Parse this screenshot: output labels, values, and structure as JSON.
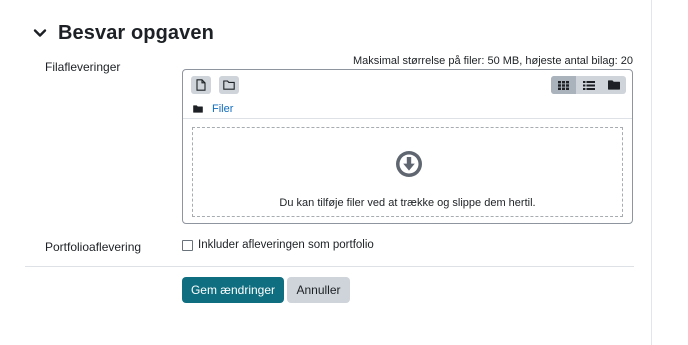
{
  "section": {
    "title": "Besvar opgaven",
    "collapse_icon": "chevron-down-icon"
  },
  "file_submissions": {
    "label": "Filafleveringer",
    "max_size_text": "Maksimal størrelse på filer: 50 MB, højeste antal bilag: 20",
    "toolbar": {
      "add_file_icon": "file-icon",
      "create_folder_icon": "folder-outline-icon",
      "view_icons_icon": "grid-icon",
      "view_list_icon": "list-icon",
      "view_tree_icon": "folder-icon",
      "active_view": "icons"
    },
    "path_label": "Filer",
    "dropzone_icon": "download-circle-icon",
    "dropzone_text": "Du kan tilføje filer ved at trække og slippe dem hertil."
  },
  "portfolio": {
    "label": "Portfolioaflevering",
    "checkbox_label": "Inkluder afleveringen som portfolio",
    "checked": false
  },
  "actions": {
    "save_label": "Gem ændringer",
    "cancel_label": "Annuller"
  },
  "colors": {
    "primary": "#0f6e7f",
    "secondary": "#ced4da",
    "link": "#0f6cbf"
  }
}
